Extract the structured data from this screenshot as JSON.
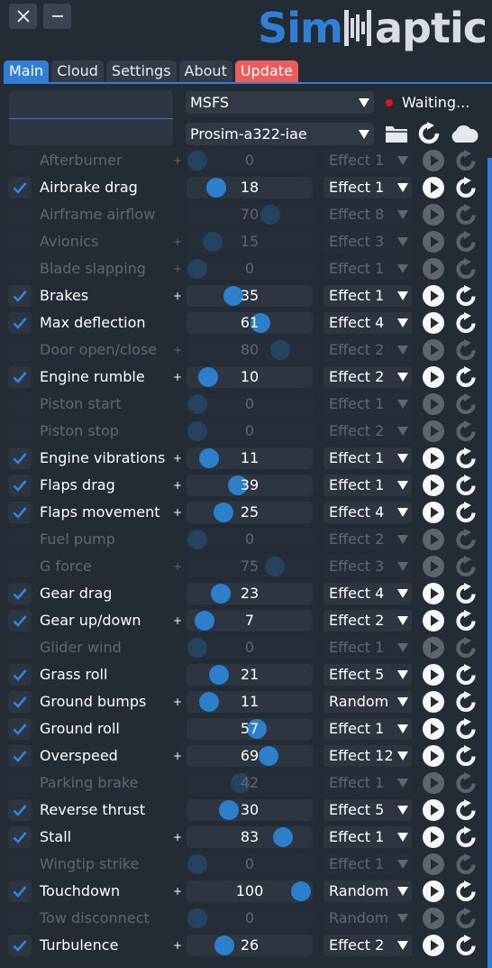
{
  "window": {
    "close_icon": "close-icon",
    "minimize_icon": "minimize-icon",
    "logo": {
      "sim": "Sim",
      "haptic": "aptic"
    }
  },
  "tabs": [
    {
      "label": "Main",
      "state": "active"
    },
    {
      "label": "Cloud",
      "state": "normal"
    },
    {
      "label": "Settings",
      "state": "normal"
    },
    {
      "label": "About",
      "state": "normal"
    },
    {
      "label": "Update",
      "state": "highlight"
    }
  ],
  "top": {
    "search_value": "",
    "sim_select": "MSFS",
    "status_text": "Waiting...",
    "status_color": "#e5141b",
    "aircraft_select": "Prosim-a322-iae",
    "icons": [
      "folder-icon",
      "refresh-icon",
      "cloud-icon"
    ]
  },
  "effects": [
    {
      "name": "Afterburner",
      "enabled": false,
      "plus": true,
      "value": 0,
      "effect": "Effect 1"
    },
    {
      "name": "Airbrake drag",
      "enabled": true,
      "plus": false,
      "value": 18,
      "effect": "Effect 1"
    },
    {
      "name": "Airframe airflow",
      "enabled": false,
      "plus": false,
      "value": 70,
      "effect": "Effect 8"
    },
    {
      "name": "Avionics",
      "enabled": false,
      "plus": true,
      "value": 15,
      "effect": "Effect 3"
    },
    {
      "name": "Blade slapping",
      "enabled": false,
      "plus": true,
      "value": 0,
      "effect": "Effect 1"
    },
    {
      "name": "Brakes",
      "enabled": true,
      "plus": true,
      "value": 35,
      "effect": "Effect 1"
    },
    {
      "name": "Max deflection",
      "enabled": true,
      "plus": false,
      "value": 61,
      "effect": "Effect 4"
    },
    {
      "name": "Door open/close",
      "enabled": false,
      "plus": true,
      "value": 80,
      "effect": "Effect 2"
    },
    {
      "name": "Engine rumble",
      "enabled": true,
      "plus": true,
      "value": 10,
      "effect": "Effect 2"
    },
    {
      "name": "Piston start",
      "enabled": false,
      "plus": false,
      "value": 0,
      "effect": "Effect 1"
    },
    {
      "name": "Piston stop",
      "enabled": false,
      "plus": false,
      "value": 0,
      "effect": "Effect 2"
    },
    {
      "name": "Engine vibrations",
      "enabled": true,
      "plus": true,
      "value": 11,
      "effect": "Effect 1"
    },
    {
      "name": "Flaps drag",
      "enabled": true,
      "plus": true,
      "value": 39,
      "effect": "Effect 1"
    },
    {
      "name": "Flaps movement",
      "enabled": true,
      "plus": true,
      "value": 25,
      "effect": "Effect 4"
    },
    {
      "name": "Fuel pump",
      "enabled": false,
      "plus": false,
      "value": 0,
      "effect": "Effect 2"
    },
    {
      "name": "G force",
      "enabled": false,
      "plus": true,
      "value": 75,
      "effect": "Effect 3"
    },
    {
      "name": "Gear drag",
      "enabled": true,
      "plus": false,
      "value": 23,
      "effect": "Effect 4"
    },
    {
      "name": "Gear up/down",
      "enabled": true,
      "plus": true,
      "value": 7,
      "effect": "Effect 2"
    },
    {
      "name": "Glider wind",
      "enabled": false,
      "plus": false,
      "value": 0,
      "effect": "Effect 1"
    },
    {
      "name": "Grass roll",
      "enabled": true,
      "plus": false,
      "value": 21,
      "effect": "Effect 5"
    },
    {
      "name": "Ground bumps",
      "enabled": true,
      "plus": true,
      "value": 11,
      "effect": "Random"
    },
    {
      "name": "Ground roll",
      "enabled": true,
      "plus": false,
      "value": 57,
      "effect": "Effect 1"
    },
    {
      "name": "Overspeed",
      "enabled": true,
      "plus": true,
      "value": 69,
      "effect": "Effect 12"
    },
    {
      "name": "Parking brake",
      "enabled": false,
      "plus": false,
      "value": 42,
      "effect": "Effect 1"
    },
    {
      "name": "Reverse thrust",
      "enabled": true,
      "plus": false,
      "value": 30,
      "effect": "Effect 5"
    },
    {
      "name": "Stall",
      "enabled": true,
      "plus": true,
      "value": 83,
      "effect": "Effect 1"
    },
    {
      "name": "Wingtip strike",
      "enabled": false,
      "plus": false,
      "value": 0,
      "effect": "Effect 1"
    },
    {
      "name": "Touchdown",
      "enabled": true,
      "plus": true,
      "value": 100,
      "effect": "Random"
    },
    {
      "name": "Tow disconnect",
      "enabled": false,
      "plus": false,
      "value": 0,
      "effect": "Random"
    },
    {
      "name": "Turbulence",
      "enabled": true,
      "plus": true,
      "value": 26,
      "effect": "Effect 2"
    }
  ],
  "colors": {
    "accent": "#2f7fd6",
    "update": "#ef5a5a",
    "background": "#232b35"
  }
}
